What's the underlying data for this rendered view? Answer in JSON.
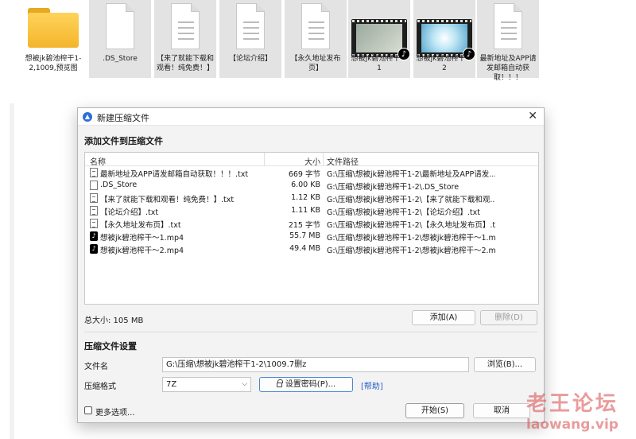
{
  "desktop": {
    "files": [
      {
        "label": "想被jk碧池榨干1-2,1009,预览图",
        "type": "folder"
      },
      {
        "label": ".DS_Store",
        "type": "doc"
      },
      {
        "label": "【来了就能下载和观看！纯免费！】",
        "type": "doc"
      },
      {
        "label": "【论坛介绍】",
        "type": "doc"
      },
      {
        "label": "【永久地址发布页】",
        "type": "doc"
      },
      {
        "label": "想被jk碧池榨干～1",
        "type": "video"
      },
      {
        "label": "想被jk碧池榨干～2",
        "type": "video"
      },
      {
        "label": "最新地址及APP请发邮箱自动获取！！！",
        "type": "doc"
      }
    ]
  },
  "dialog": {
    "title": "新建压缩文件",
    "section_add": "添加文件到压缩文件",
    "columns": {
      "name": "名称",
      "size": "大小",
      "path": "文件路径"
    },
    "rows": [
      {
        "icon": "txt",
        "name": "最新地址及APP请发邮箱自动获取！！！.txt",
        "size": "669 字节",
        "path": "G:\\压缩\\想被jk碧池榨干1-2\\最新地址及APP请发..."
      },
      {
        "icon": "blank",
        "name": ".DS_Store",
        "size": "6.00 KB",
        "path": "G:\\压缩\\想被jk碧池榨干1-2\\.DS_Store"
      },
      {
        "icon": "txt",
        "name": "【来了就能下载和观看！纯免费！】.txt",
        "size": "1.12 KB",
        "path": "G:\\压缩\\想被jk碧池榨干1-2\\【来了就能下载和观..."
      },
      {
        "icon": "txt",
        "name": "【论坛介绍】.txt",
        "size": "1.11 KB",
        "path": "G:\\压缩\\想被jk碧池榨干1-2\\【论坛介绍】.txt"
      },
      {
        "icon": "txt",
        "name": "【永久地址发布页】.txt",
        "size": "215 字节",
        "path": "G:\\压缩\\想被jk碧池榨干1-2\\【永久地址发布页】.txt"
      },
      {
        "icon": "tiktok",
        "name": "想被jk碧池榨干～1.mp4",
        "size": "55.7 MB",
        "path": "G:\\压缩\\想被jk碧池榨干1-2\\想被jk碧池榨干～1.m..."
      },
      {
        "icon": "tiktok",
        "name": "想被jk碧池榨干～2.mp4",
        "size": "49.4 MB",
        "path": "G:\\压缩\\想被jk碧池榨干1-2\\想被jk碧池榨干～2.m..."
      }
    ],
    "total_size": "总大小: 105 MB",
    "add_button": "添加(A)",
    "delete_button": "删除(D)",
    "section_settings": "压缩文件设置",
    "filename_label": "文件名",
    "filename_value": "G:\\压缩\\想被jk碧池榨干1-2\\1009.7删z",
    "browse_button": "浏览(B)...",
    "format_label": "压缩格式",
    "format_value": "7Z",
    "password_button": "设置密码(P)...",
    "help_link": "[帮助]",
    "more_options": "更多选项...",
    "start_button": "开始(S)",
    "cancel_button": "取消"
  },
  "watermark": {
    "title": "老王论坛",
    "url": "laowang.vip"
  }
}
